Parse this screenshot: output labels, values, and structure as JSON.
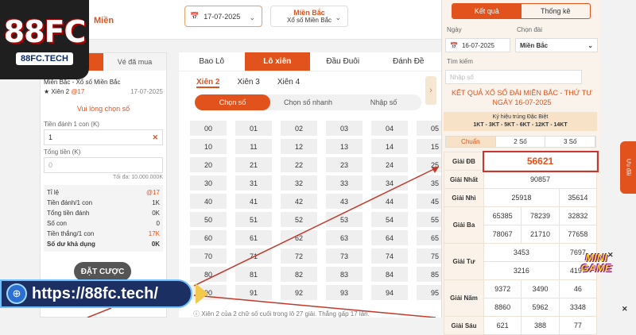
{
  "brand": {
    "logo_text": "88FC",
    "logo_sub": "88FC.TECH",
    "word": "Miền"
  },
  "header": {
    "date": "17-07-2025",
    "region_title": "Miền Bắc",
    "region_sub": "Xổ số Miền Bắc"
  },
  "left": {
    "tab_active": "",
    "tab_other": "Vé đã mua",
    "region_line": "Miền Bắc - Xổ số Miền Bắc",
    "bet_label": "★ Xiên 2 ",
    "bet_odds": "@17",
    "bet_date": "17-07-2025",
    "prompt": "Vui lòng chọn số",
    "stake_label": "Tiền đánh 1 con (K)",
    "stake_value": "1",
    "total_label": "Tổng tiền (K)",
    "total_value": "0",
    "max_note": "Tối đa: 10.000.000K",
    "stats": [
      {
        "k": "Tỉ lệ",
        "v": "@17",
        "red": true
      },
      {
        "k": "Tiền đánh/1 con",
        "v": "1K",
        "red": false
      },
      {
        "k": "Tổng tiền đánh",
        "v": "0K",
        "red": false
      },
      {
        "k": "Số con",
        "v": "0",
        "red": false
      },
      {
        "k": "Tiền thắng/1 con",
        "v": "17K",
        "red": true
      },
      {
        "k": "Số dư khả dụng",
        "v": "0K",
        "red": false
      }
    ],
    "bet_button": "ĐẶT CƯỢC"
  },
  "middle": {
    "tabs": [
      "Bao Lô",
      "Lô xiên",
      "Đầu Đuôi",
      "Đánh Đề"
    ],
    "sub_tabs": [
      "Xiên 2",
      "Xiên 3",
      "Xiên 4"
    ],
    "modes": [
      "Chọn số",
      "Chọn số nhanh",
      "Nhập số"
    ],
    "numbers": [
      "00",
      "01",
      "02",
      "03",
      "04",
      "05",
      "10",
      "11",
      "12",
      "13",
      "14",
      "15",
      "20",
      "21",
      "22",
      "23",
      "24",
      "25",
      "30",
      "31",
      "32",
      "33",
      "34",
      "35",
      "40",
      "41",
      "42",
      "43",
      "44",
      "45",
      "50",
      "51",
      "52",
      "53",
      "54",
      "55",
      "60",
      "61",
      "62",
      "63",
      "64",
      "65",
      "70",
      "71",
      "72",
      "73",
      "74",
      "75",
      "80",
      "81",
      "82",
      "83",
      "84",
      "85",
      "90",
      "91",
      "92",
      "93",
      "94",
      "95"
    ],
    "note": "Xiên 2 của 2 chữ số cuối trong lô 27 giải. Thắng gấp 17 lần."
  },
  "right": {
    "tabs": [
      "Kết quả",
      "Thống kê"
    ],
    "date_label": "Ngày",
    "date_value": "16-07-2025",
    "region_label": "Chọn đài",
    "region_value": "Miền Bắc",
    "search_label": "Tìm kiếm",
    "search_placeholder": "Nhập số",
    "title1": "KẾT QUẢ XỔ SỐ ĐÀI MIỀN BẮC - THỨ TƯ",
    "title2": "NGÀY 16-07-2025",
    "kyhieu_label": "Ký hiệu trúng Đặc Biệt",
    "kyhieu_codes": "1KT - 3KT - 5KT - 6KT - 12KT - 14KT",
    "modes": [
      "Chuẩn",
      "2 Số",
      "3 Số"
    ],
    "results": {
      "db_label": "Giải ĐB",
      "db": "56621",
      "nhat_label": "Giải Nhất",
      "nhat": "90857",
      "nhi_label": "Giải Nhì",
      "nhi": [
        "25918",
        "35614"
      ],
      "ba_label": "Giải Ba",
      "ba": [
        "65385",
        "78239",
        "32832",
        "78067",
        "21710",
        "77658"
      ],
      "tu_label": "Giải Tư",
      "tu": [
        "3453",
        "7697",
        "3216",
        "4197"
      ],
      "nam_label": "Giải Năm",
      "nam": [
        "9372",
        "3490",
        "46",
        "8860",
        "5962",
        "3348"
      ],
      "sau_label": "Giải Sáu",
      "sau": [
        "621",
        "388",
        "77"
      ]
    }
  },
  "overlay": {
    "url": "https://88fc.tech/",
    "gift": "Ưu đãi",
    "minigame": "MINI GAME"
  }
}
